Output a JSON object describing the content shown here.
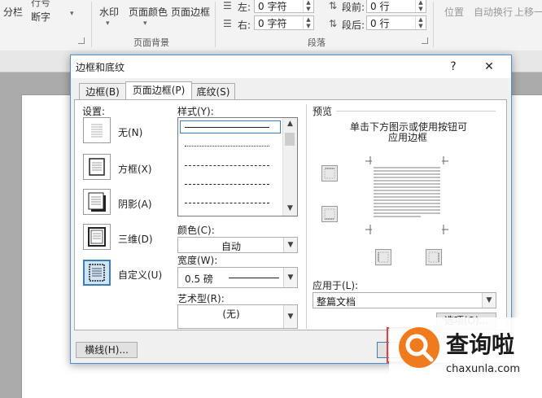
{
  "ribbon": {
    "col1": {
      "item1": "分栏",
      "item2": "断字"
    },
    "watermark": "水印",
    "page_color": "页面颜色",
    "page_borders": "页面边框",
    "group_page_bg": "页面背景",
    "indent_left_label": "左:",
    "indent_left_value": "0 字符",
    "indent_right_label": "右:",
    "indent_right_value": "0 字符",
    "spacing_before_label": "段前:",
    "spacing_before_value": "0 行",
    "spacing_after_label": "段后:",
    "spacing_after_value": "0 行",
    "group_paragraph": "段落",
    "position": "位置",
    "wrap_text": "自动换行",
    "bring_forward": "上移一"
  },
  "dialog": {
    "title": "边框和底纹",
    "help": "?",
    "close": "✕",
    "tabs": [
      "边框(B)",
      "页面边框(P)",
      "底纹(S)"
    ],
    "settings_label": "设置:",
    "settings": [
      "无(N)",
      "方框(X)",
      "阴影(A)",
      "三维(D)",
      "自定义(U)"
    ],
    "style_label": "样式(Y):",
    "color_label": "颜色(C):",
    "color_value": "自动",
    "width_label": "宽度(W):",
    "width_value": "0.5 磅",
    "art_label": "艺术型(R):",
    "art_value": "(无)",
    "preview_label": "预览",
    "preview_hint_1": "单击下方图示或使用按钮可",
    "preview_hint_2": "应用边框",
    "apply_to_label": "应用于(L):",
    "apply_to_value": "整篇文档",
    "options_button": "选项(O)...",
    "horizontal_line_button": "横线(H)..."
  },
  "watermark_logo": {
    "name": "查询啦",
    "url": "chaxunla.com"
  }
}
